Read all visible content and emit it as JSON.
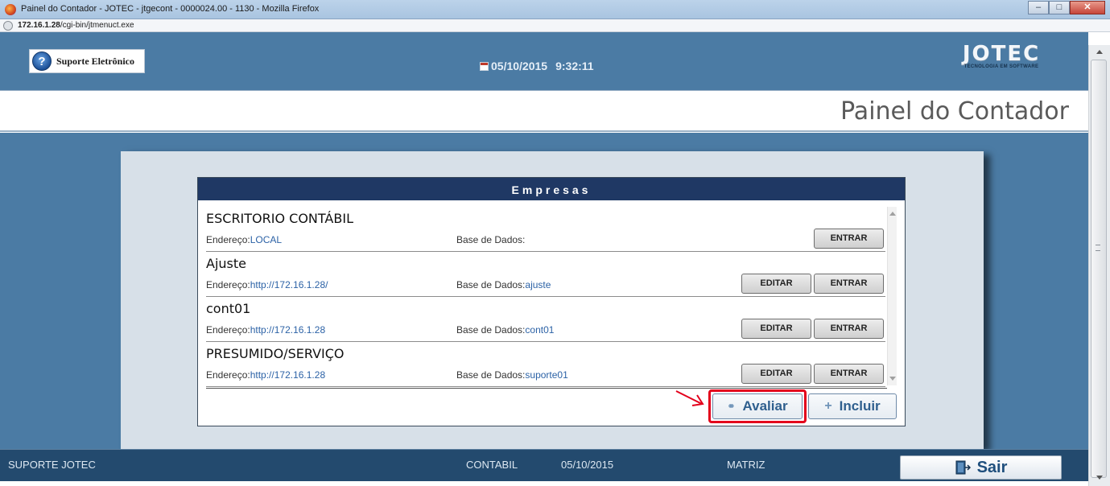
{
  "window": {
    "title": "Painel do Contador - JOTEC - jtgecont - 0000024.00 - 1130 - Mozilla Firefox",
    "url_host": "172.16.1.28",
    "url_path": "/cgi-bin/jtmenuct.exe"
  },
  "header": {
    "support_label": "Suporte Eletrônico",
    "date": "05/10/2015",
    "time": "9:32:11",
    "logo_text": "JOTEC",
    "logo_tagline": "TECNOLOGIA EM SOFTWARE"
  },
  "page_title": "Painel do Contador",
  "empresas": {
    "heading": "Empresas",
    "address_label": "Endereço:",
    "db_label": "Base de Dados:",
    "edit_label": "EDITAR",
    "enter_label": "ENTRAR",
    "companies": [
      {
        "name": "ESCRITORIO CONTÁBIL",
        "address": "LOCAL",
        "database": ""
      },
      {
        "name": "Ajuste",
        "address": "http://172.16.1.28/",
        "database": "ajuste"
      },
      {
        "name": "cont01",
        "address": "http://172.16.1.28",
        "database": "cont01"
      },
      {
        "name": "PRESUMIDO/SERVIÇO",
        "address": "http://172.16.1.28",
        "database": "suporte01"
      }
    ],
    "avaliar_label": "Avaliar",
    "incluir_label": "Incluir"
  },
  "footer": {
    "user": "SUPORTE JOTEC",
    "module": "CONTABIL",
    "date": "05/10/2015",
    "branch": "MATRIZ",
    "exit_label": "Sair"
  },
  "colors": {
    "header_bg": "#4b7ba4",
    "box_header_bg": "#1f3864",
    "footer_bg": "#234a6e",
    "highlight": "#e3001b",
    "link": "#2c62a6"
  }
}
